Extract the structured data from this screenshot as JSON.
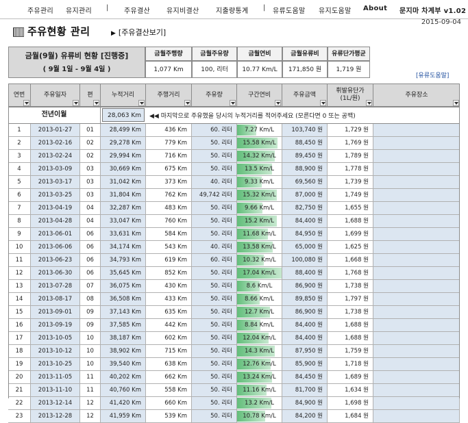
{
  "menu": {
    "items": [
      "주유관리",
      "유지관리",
      "주유결산",
      "유지비결산",
      "지출량통계",
      "유류도움말",
      "유지도움말",
      "About"
    ],
    "sep": "|",
    "app_title": "문지마 차계부 v1.02"
  },
  "date": "2015-09-04",
  "page": {
    "title": "주유현황 관리",
    "report_link": "[주유결산보기]"
  },
  "summary": {
    "title": "금월(9월) 유류비 현황 [진행중]",
    "subtitle": "( 9월 1일 - 9월 4일 )",
    "headers": [
      "금월주행량",
      "금월주유량",
      "금월연비",
      "금월유류비",
      "유류단가평균"
    ],
    "values": [
      "1,077 Km",
      "100, 리터",
      "10.77 Km/L",
      "171,850 원",
      "1,719 원"
    ]
  },
  "help_link": "[유류도움말]",
  "table": {
    "headers": [
      "연번",
      "주유일자",
      "편",
      "누적거리",
      "주행거리",
      "주유량",
      "구간연비",
      "주유금액",
      "휘발유단가\n(1L/원)",
      "주유장소"
    ],
    "prev_year": {
      "label": "전년이월",
      "value": "28,063 Km",
      "note": "◀◀  마지막으로 주유했을 당시의 누적거리를 적어주세요 (모른다면 0 또는 공백)"
    },
    "rows": [
      [
        "1",
        "2013-01-27",
        "01",
        "28,499 Km",
        "436 Km",
        "60. 리터",
        "7.27 Km/L",
        "103,740 원",
        "1,729 원",
        ""
      ],
      [
        "2",
        "2013-02-16",
        "02",
        "29,278 Km",
        "779 Km",
        "50. 리터",
        "15.58 Km/L",
        "88,450 원",
        "1,769 원",
        ""
      ],
      [
        "3",
        "2013-02-24",
        "02",
        "29,994 Km",
        "716 Km",
        "50. 리터",
        "14.32 Km/L",
        "89,450 원",
        "1,789 원",
        ""
      ],
      [
        "4",
        "2013-03-09",
        "03",
        "30,669 Km",
        "675 Km",
        "50. 리터",
        "13.5 Km/L",
        "88,900 원",
        "1,778 원",
        ""
      ],
      [
        "5",
        "2013-03-17",
        "03",
        "31,042 Km",
        "373 Km",
        "40. 리터",
        "9.33 Km/L",
        "69,560 원",
        "1,739 원",
        ""
      ],
      [
        "6",
        "2013-03-25",
        "03",
        "31,804 Km",
        "762 Km",
        "49,742 리터",
        "15.32 Km/L",
        "87,000 원",
        "1,749 원",
        ""
      ],
      [
        "7",
        "2013-04-19",
        "04",
        "32,287 Km",
        "483 Km",
        "50. 리터",
        "9.66 Km/L",
        "82,750 원",
        "1,655 원",
        ""
      ],
      [
        "8",
        "2013-04-28",
        "04",
        "33,047 Km",
        "760 Km",
        "50. 리터",
        "15.2 Km/L",
        "84,400 원",
        "1,688 원",
        ""
      ],
      [
        "9",
        "2013-06-01",
        "06",
        "33,631 Km",
        "584 Km",
        "50. 리터",
        "11.68 Km/L",
        "84,950 원",
        "1,699 원",
        ""
      ],
      [
        "10",
        "2013-06-06",
        "06",
        "34,174 Km",
        "543 Km",
        "40. 리터",
        "13.58 Km/L",
        "65,000 원",
        "1,625 원",
        ""
      ],
      [
        "11",
        "2013-06-23",
        "06",
        "34,793 Km",
        "619 Km",
        "60. 리터",
        "10.32 Km/L",
        "100,080 원",
        "1,668 원",
        ""
      ],
      [
        "12",
        "2013-06-30",
        "06",
        "35,645 Km",
        "852 Km",
        "50. 리터",
        "17.04 Km/L",
        "88,400 원",
        "1,768 원",
        ""
      ],
      [
        "13",
        "2013-07-28",
        "07",
        "36,075 Km",
        "430 Km",
        "50. 리터",
        "8.6 Km/L",
        "86,900 원",
        "1,738 원",
        ""
      ],
      [
        "14",
        "2013-08-17",
        "08",
        "36,508 Km",
        "433 Km",
        "50. 리터",
        "8.66 Km/L",
        "89,850 원",
        "1,797 원",
        ""
      ],
      [
        "15",
        "2013-09-01",
        "09",
        "37,143 Km",
        "635 Km",
        "50. 리터",
        "12.7 Km/L",
        "86,900 원",
        "1,738 원",
        ""
      ],
      [
        "16",
        "2013-09-19",
        "09",
        "37,585 Km",
        "442 Km",
        "50. 리터",
        "8.84 Km/L",
        "84,400 원",
        "1,688 원",
        ""
      ],
      [
        "17",
        "2013-10-05",
        "10",
        "38,187 Km",
        "602 Km",
        "50. 리터",
        "12.04 Km/L",
        "84,400 원",
        "1,688 원",
        ""
      ],
      [
        "18",
        "2013-10-12",
        "10",
        "38,902 Km",
        "715 Km",
        "50. 리터",
        "14.3 Km/L",
        "87,950 원",
        "1,759 원",
        ""
      ],
      [
        "19",
        "2013-10-25",
        "10",
        "39,540 Km",
        "638 Km",
        "50. 리터",
        "12.76 Km/L",
        "85,900 원",
        "1,718 원",
        ""
      ],
      [
        "20",
        "2013-11-05",
        "11",
        "40,202 Km",
        "662 Km",
        "50. 리터",
        "13.24 Km/L",
        "84,450 원",
        "1,689 원",
        ""
      ],
      [
        "21",
        "2013-11-10",
        "11",
        "40,760 Km",
        "558 Km",
        "50. 리터",
        "11.16 Km/L",
        "81,700 원",
        "1,634 원",
        ""
      ],
      [
        "22",
        "2013-12-14",
        "12",
        "41,420 Km",
        "660 Km",
        "50. 리터",
        "13.2 Km/L",
        "84,900 원",
        "1,698 원",
        ""
      ],
      [
        "23",
        "2013-12-28",
        "12",
        "41,959 Km",
        "539 Km",
        "50. 리터",
        "10.78 Km/L",
        "84,200 원",
        "1,684 원",
        ""
      ]
    ],
    "efficiency_bar_max": 17.04,
    "colors": {
      "header": "#d9d9d9",
      "input_fill": "#dce6f1",
      "efficiency_bar": "#63be7b"
    }
  }
}
